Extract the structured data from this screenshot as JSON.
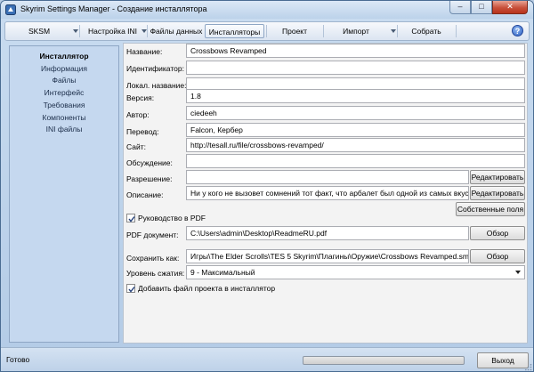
{
  "window": {
    "title": "Skyrim Settings Manager - Создание инсталлятора"
  },
  "menubar": {
    "skm": "SKSM",
    "ini": "Настройка INI",
    "data": "Файлы данных",
    "installers": "Инсталляторы",
    "project": "Проект",
    "import": "Импорт",
    "build": "Собрать"
  },
  "nav": {
    "items": [
      "Инсталлятор",
      "Информация",
      "Файлы",
      "Интерфейс",
      "Требования",
      "Компоненты",
      "INI файлы"
    ]
  },
  "form": {
    "labels": {
      "name": "Название:",
      "id": "Идентификатор:",
      "local_name": "Локал. название:",
      "version": "Версия:",
      "author": "Автор:",
      "translation": "Перевод:",
      "site": "Сайт:",
      "discussion": "Обсуждение:",
      "permission": "Разрешение:",
      "description": "Описание:",
      "pdf_doc": "PDF документ:",
      "save_as": "Сохранить как:",
      "compression": "Уровень сжатия:"
    },
    "values": {
      "name": "Crossbows Revamped",
      "id": "",
      "local_name": "",
      "version": "1.8",
      "author": "ciedeeh",
      "translation": "Falcon, Кербер",
      "site": "http://tesall.ru/file/crossbows-revamped/",
      "discussion": "",
      "permission": "",
      "description": "Ни у кого не вызовет сомнений тот факт, что арбалет был одной из самых вкусн",
      "pdf_doc": "C:\\Users\\admin\\Desktop\\ReadmeRU.pdf",
      "save_as": "Игры\\The Elder Scrolls\\TES 5 Skyrim\\Плагины\\Оружие\\Crossbows Revamped.smi",
      "compression": "9 - Максимальный"
    },
    "buttons": {
      "edit_permission": "Редактировать",
      "edit_description": "Редактировать",
      "own_fields": "Собственные поля",
      "browse_pdf": "Обзор",
      "browse_save": "Обзор"
    },
    "checkboxes": {
      "pdf_guide": "Руководство в PDF",
      "pdf_guide_checked": true,
      "add_project": "Добавить файл проекта в инсталлятор",
      "add_project_checked": true
    }
  },
  "status": {
    "text": "Готово",
    "progress": 0,
    "exit": "Выход"
  }
}
